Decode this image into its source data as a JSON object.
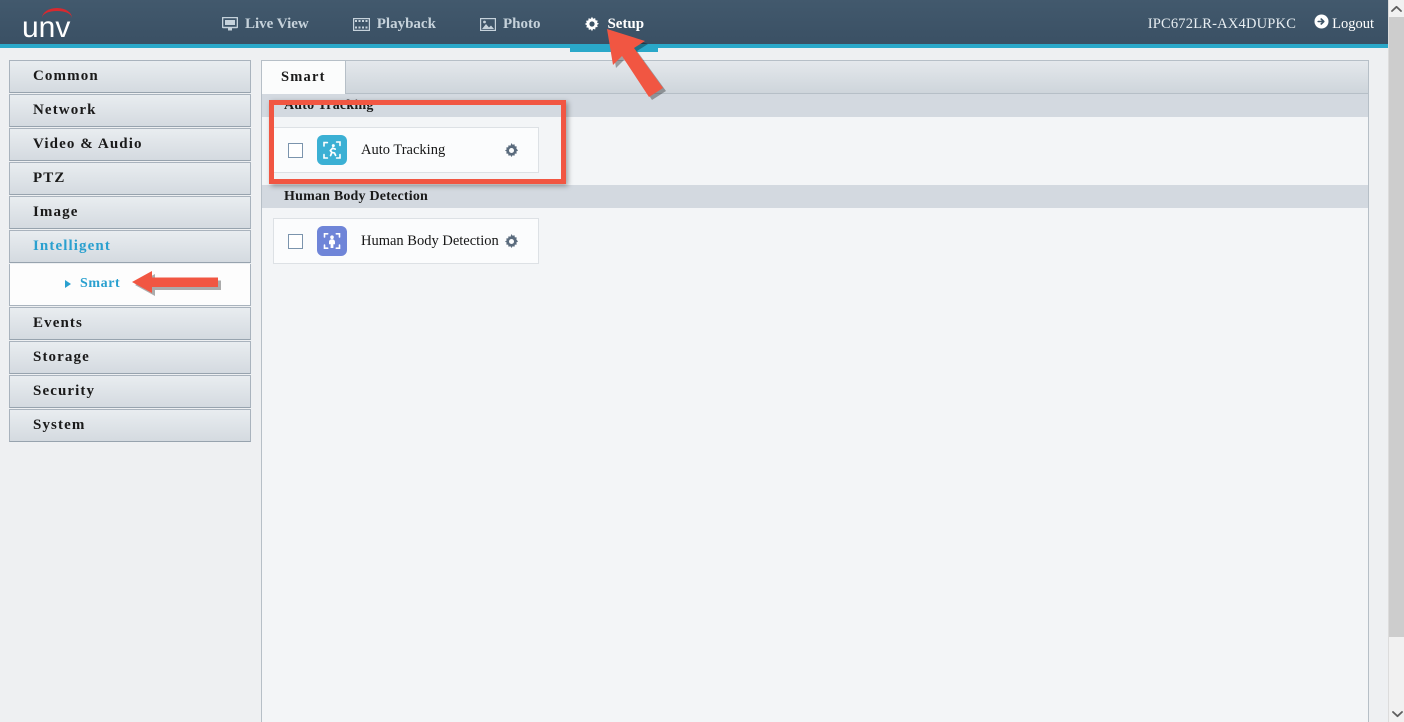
{
  "header": {
    "logo_text": "unv",
    "nav": [
      {
        "label": "Live View",
        "icon": "monitor-icon",
        "active": false
      },
      {
        "label": "Playback",
        "icon": "film-icon",
        "active": false
      },
      {
        "label": "Photo",
        "icon": "image-icon",
        "active": false
      },
      {
        "label": "Setup",
        "icon": "gear-icon",
        "active": true
      }
    ],
    "device_name": "IPC672LR-AX4DUPKC",
    "logout_label": "Logout",
    "accent_color": "#2aa8c9",
    "background_color": "#3d5467"
  },
  "sidebar": {
    "items": [
      {
        "label": "Common",
        "selected": false
      },
      {
        "label": "Network",
        "selected": false
      },
      {
        "label": "Video & Audio",
        "selected": false
      },
      {
        "label": "PTZ",
        "selected": false
      },
      {
        "label": "Image",
        "selected": false
      },
      {
        "label": "Intelligent",
        "selected": true
      }
    ],
    "submenu": [
      {
        "label": "Smart",
        "selected": true
      }
    ],
    "items_after": [
      {
        "label": "Events",
        "selected": false
      },
      {
        "label": "Storage",
        "selected": false
      },
      {
        "label": "Security",
        "selected": false
      },
      {
        "label": "System",
        "selected": false
      }
    ],
    "selected_color": "#2aa0cf"
  },
  "content": {
    "tabs": [
      {
        "label": "Smart",
        "active": true
      }
    ],
    "sections": [
      {
        "title": "Auto Tracking",
        "feature": {
          "label": "Auto Tracking",
          "icon": "auto-tracking-icon",
          "icon_color": "#3bb0d4",
          "checked": false,
          "gear": "gear-icon"
        }
      },
      {
        "title": "Human Body Detection",
        "feature": {
          "label": "Human Body Detection",
          "icon": "human-body-icon",
          "icon_color": "#6f85d8",
          "checked": false,
          "gear": "gear-icon"
        }
      }
    ]
  },
  "annotations": {
    "color": "#f15642",
    "highlight_box": "auto-tracking-section",
    "arrows": [
      {
        "points_to": "setup-nav-item",
        "direction": "up-left"
      },
      {
        "points_to": "sidebar-item-smart",
        "direction": "left"
      }
    ]
  },
  "scrollbar": {
    "up_icon": "chevron-up-icon",
    "down_icon": "chevron-down-icon"
  }
}
